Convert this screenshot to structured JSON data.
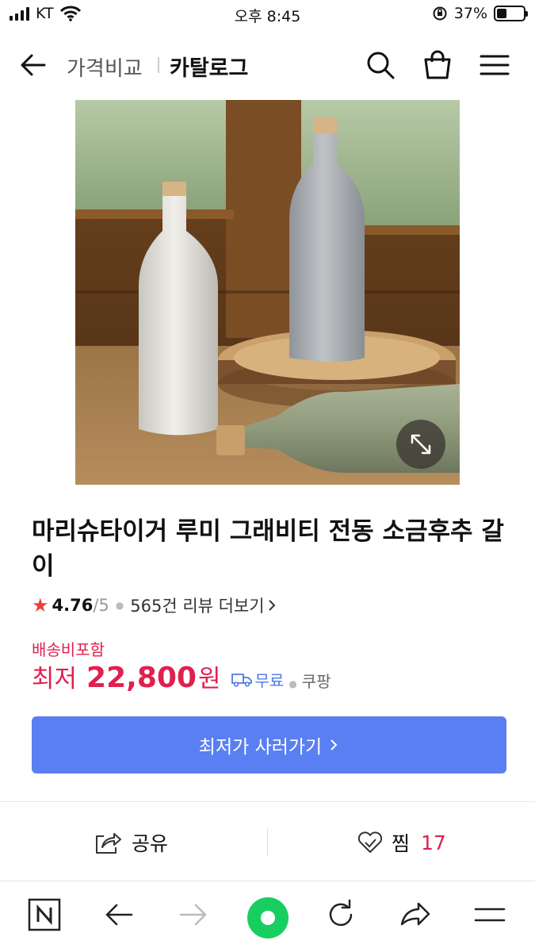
{
  "status_bar": {
    "carrier": "KT",
    "time": "오후 8:45",
    "battery": "37%",
    "battery_level": 0.37
  },
  "nav": {
    "back_icon": "arrow-left-icon",
    "crumb_compare": "가격비교",
    "crumb_catalog": "카탈로그",
    "icons": [
      "search-icon",
      "shopping-bag-icon",
      "menu-icon"
    ]
  },
  "product": {
    "title": "마리슈타이거 루미 그래비티 전동 소금후추 갈이",
    "rating": "4.76",
    "rating_max": "/5",
    "reviews": "565건 리뷰 더보기",
    "shipping_note": "배송비포함",
    "price_label": "최저",
    "price": "22,800",
    "price_unit": "원",
    "free_shipping": "무료",
    "mall": "쿠팡",
    "buy_button": "최저가 사러가기"
  },
  "actions": {
    "share": "공유",
    "favorite": "찜",
    "favorite_count": "17"
  },
  "toolbar": {
    "icons": [
      "naver-n-icon",
      "back-arrow-icon",
      "forward-arrow-icon",
      "home-green-icon",
      "refresh-icon",
      "share-arrow-icon",
      "menu-icon"
    ]
  },
  "colors": {
    "accent": "#5a7ff2",
    "price": "#e0204f",
    "star": "#e8413c",
    "home": "#19ce60"
  }
}
